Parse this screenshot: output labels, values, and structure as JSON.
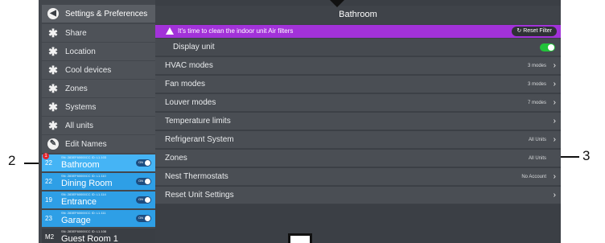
{
  "callouts": {
    "left": "2",
    "right": "3"
  },
  "sidebar": {
    "header": {
      "label": "Settings & Preferences",
      "icon": "back-arrow-icon"
    },
    "items": [
      {
        "label": "Share",
        "icon": "asterisk-icon"
      },
      {
        "label": "Location",
        "icon": "asterisk-icon"
      },
      {
        "label": "Cool devices",
        "icon": "asterisk-icon"
      },
      {
        "label": "Zones",
        "icon": "asterisk-icon"
      },
      {
        "label": "Systems",
        "icon": "asterisk-icon"
      },
      {
        "label": "All units",
        "icon": "asterisk-icon"
      },
      {
        "label": "Edit Names",
        "icon": "pencil-icon"
      }
    ],
    "units": [
      {
        "temp": "22",
        "sn": "SN: 283EF60000CC ID: L1.103",
        "name": "Bathroom",
        "toggle": "ON",
        "badge": "1"
      },
      {
        "temp": "22",
        "sn": "SN: 283EF60000CC ID: L1.110",
        "name": "Dining Room",
        "toggle": "ON"
      },
      {
        "temp": "19",
        "sn": "SN: 283EF60000CC ID: L1.114",
        "name": "Entrance",
        "toggle": "ON"
      },
      {
        "temp": "23",
        "sn": "SN: 283EF60000CC ID: L1.111",
        "name": "Garage",
        "toggle": "ON"
      },
      {
        "temp": "M2",
        "sn": "SN: 283EF60000CC ID: L1.108",
        "name": "Guest Room 1"
      }
    ]
  },
  "main": {
    "title": "Bathroom",
    "alert": {
      "text": "It's time to clean the indoor unit Air filters",
      "button": "Reset Filter"
    },
    "display_unit": {
      "label": "Display unit"
    },
    "rows": [
      {
        "label": "HVAC modes",
        "value": "3 modes"
      },
      {
        "label": "Fan modes",
        "value": "3 modes"
      },
      {
        "label": "Louver modes",
        "value": "7 modes"
      },
      {
        "label": "Temperature limits",
        "value": ""
      },
      {
        "label": "Refrigerant System",
        "value": "All Units"
      },
      {
        "label": "Zones",
        "value": "All Units"
      },
      {
        "label": "Nest Thermostats",
        "value": "No Account"
      },
      {
        "label": "Reset Unit Settings",
        "value": ""
      }
    ]
  },
  "colors": {
    "alert": "#a232d9",
    "unit_blue": "#2e9fe6",
    "toggle_green": "#22c23a"
  }
}
